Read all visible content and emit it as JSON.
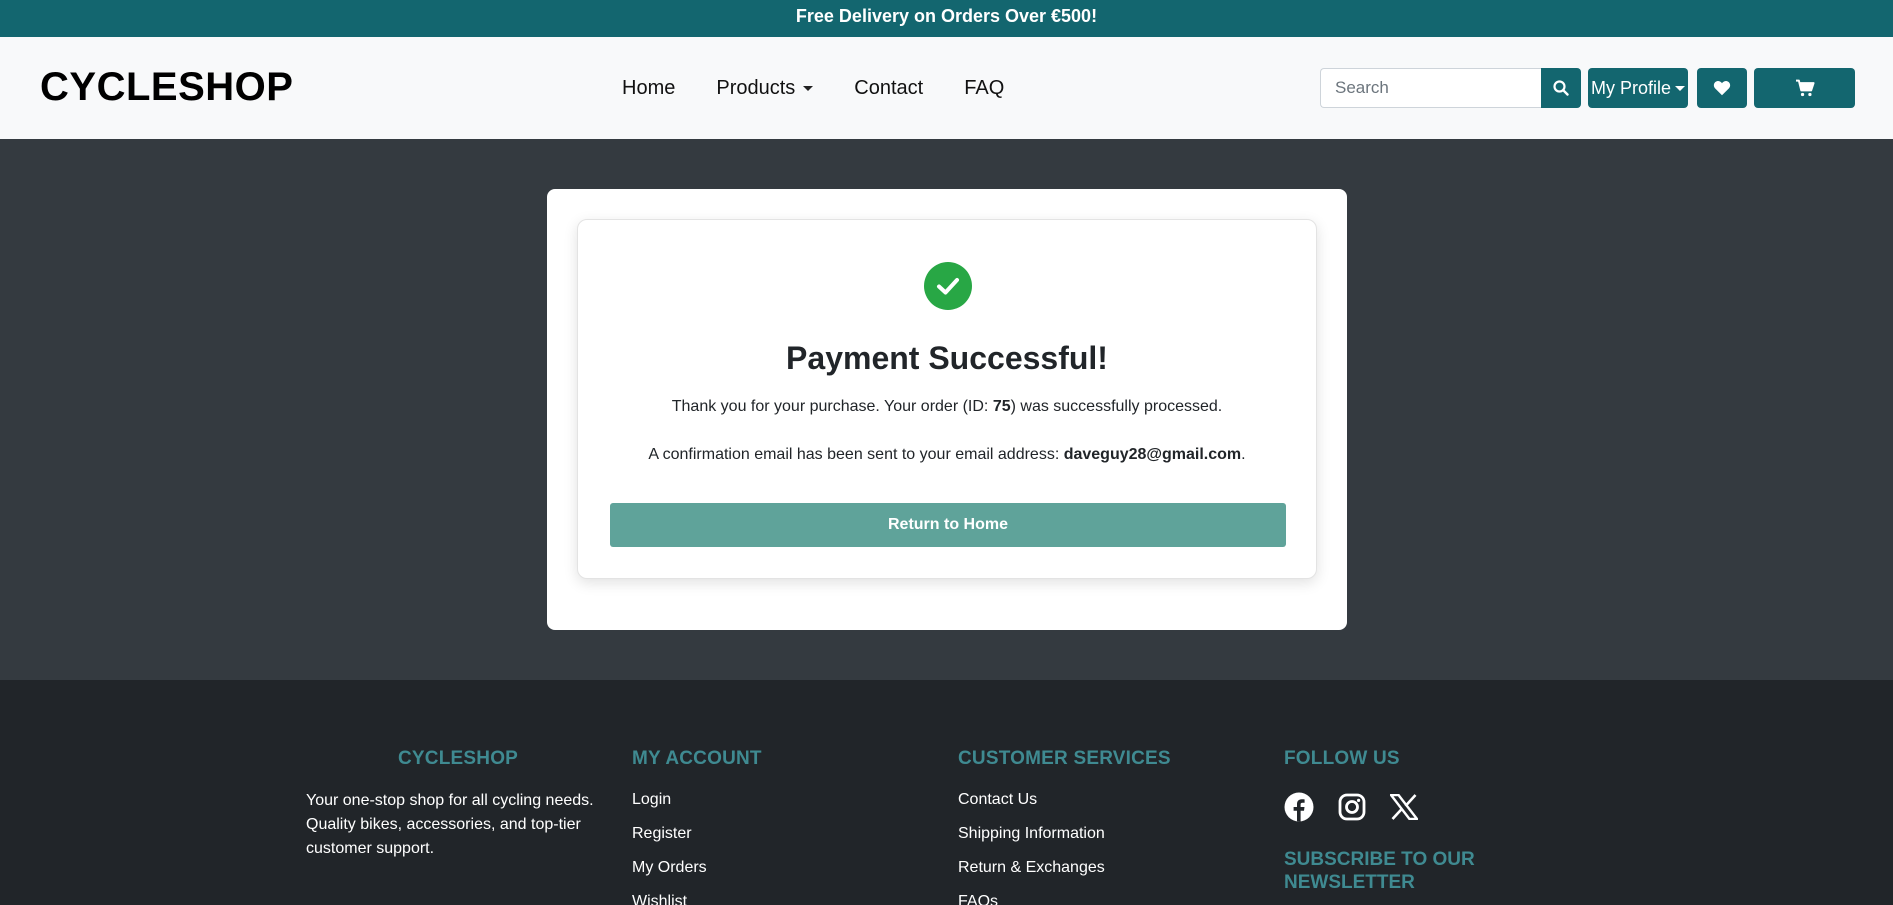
{
  "topbar": {
    "text": "Free Delivery on Orders Over €500!"
  },
  "header": {
    "logo": "CYCLESHOP",
    "nav": [
      "Home",
      "Products",
      "Contact",
      "FAQ"
    ],
    "search_placeholder": "Search",
    "profile_label": "My Profile"
  },
  "payment": {
    "title": "Payment Successful!",
    "line1_prefix": "Thank you for your purchase. Your order (ID: ",
    "order_id": "75",
    "line1_suffix": ") was successfully processed.",
    "line2_prefix": "A confirmation email has been sent to your email address: ",
    "email": "daveguy28@gmail.com",
    "line2_suffix": ".",
    "button": "Return to Home"
  },
  "footer": {
    "brand_heading": "CYCLESHOP",
    "brand_text": "Your one-stop shop for all cycling needs. Quality bikes, accessories, and top-tier customer support.",
    "account_heading": "MY ACCOUNT",
    "account_links": [
      "Login",
      "Register",
      "My Orders",
      "Wishlist"
    ],
    "services_heading": "CUSTOMER SERVICES",
    "services_links": [
      "Contact Us",
      "Shipping Information",
      "Return & Exchanges",
      "FAQs"
    ],
    "follow_heading": "FOLLOW US",
    "social_icons": [
      "facebook-icon",
      "instagram-icon",
      "x-icon"
    ],
    "newsletter_heading": "SUBSCRIBE TO OUR NEWSLETTER"
  },
  "colors": {
    "brand": "#13666f",
    "success": "#28a745",
    "button": "#5fa39a",
    "footer_heading": "#3f8a91"
  }
}
